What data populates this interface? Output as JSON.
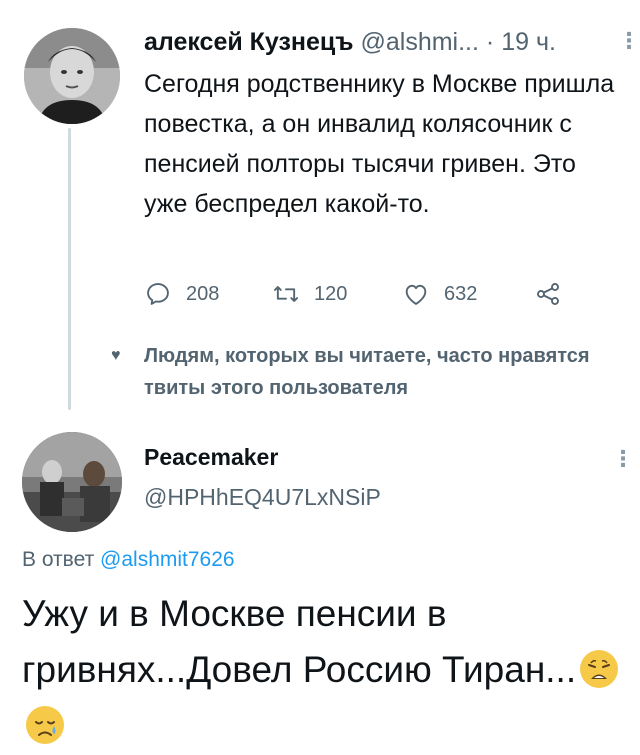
{
  "tweet1": {
    "author_name": "алексей Кузнецъ",
    "handle_truncated": "@alshmi...",
    "separator": "·",
    "time": "19 ч.",
    "text": "Сегодня родственнику в Москве пришла повестка, а он инвалид колясочник с пенсией полторы тысячи гривен. Это уже беспредел какой-то.",
    "actions": {
      "replies": "208",
      "retweets": "120",
      "likes": "632"
    }
  },
  "suggestion": {
    "text": "Людям, которых вы читаете, часто нравятся твиты этого пользователя"
  },
  "tweet2": {
    "author_name": "Peacemaker",
    "handle": "@HPHhEQ4U7LxNSiP",
    "reply_prefix": "В ответ",
    "reply_mention": "@alshmit7626",
    "text": "Ужу и в Москве пенсии в гривнях...Довел Россию Тиран...",
    "emojis": [
      "weary-face-emoji",
      "sad-crying-face-emoji"
    ]
  },
  "icons": {
    "reply": "reply-icon",
    "retweet": "retweet-icon",
    "like": "heart-icon",
    "share": "share-icon",
    "more": "more-options-icon"
  },
  "colors": {
    "text_primary": "#0f1419",
    "text_secondary": "#536471",
    "link": "#1d9bf0",
    "thread_line": "#cfd9de"
  }
}
